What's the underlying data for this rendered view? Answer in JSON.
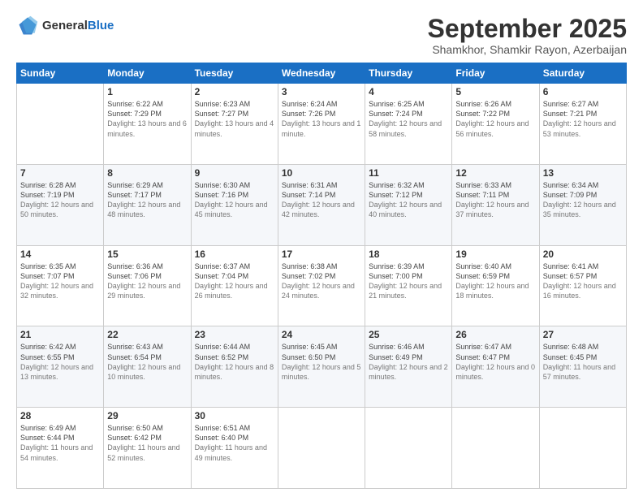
{
  "header": {
    "logo_line1": "General",
    "logo_line2": "Blue",
    "month": "September 2025",
    "location": "Shamkhor, Shamkir Rayon, Azerbaijan"
  },
  "weekdays": [
    "Sunday",
    "Monday",
    "Tuesday",
    "Wednesday",
    "Thursday",
    "Friday",
    "Saturday"
  ],
  "weeks": [
    [
      {
        "day": "",
        "sunrise": "",
        "sunset": "",
        "daylight": ""
      },
      {
        "day": "1",
        "sunrise": "Sunrise: 6:22 AM",
        "sunset": "Sunset: 7:29 PM",
        "daylight": "Daylight: 13 hours and 6 minutes."
      },
      {
        "day": "2",
        "sunrise": "Sunrise: 6:23 AM",
        "sunset": "Sunset: 7:27 PM",
        "daylight": "Daylight: 13 hours and 4 minutes."
      },
      {
        "day": "3",
        "sunrise": "Sunrise: 6:24 AM",
        "sunset": "Sunset: 7:26 PM",
        "daylight": "Daylight: 13 hours and 1 minute."
      },
      {
        "day": "4",
        "sunrise": "Sunrise: 6:25 AM",
        "sunset": "Sunset: 7:24 PM",
        "daylight": "Daylight: 12 hours and 58 minutes."
      },
      {
        "day": "5",
        "sunrise": "Sunrise: 6:26 AM",
        "sunset": "Sunset: 7:22 PM",
        "daylight": "Daylight: 12 hours and 56 minutes."
      },
      {
        "day": "6",
        "sunrise": "Sunrise: 6:27 AM",
        "sunset": "Sunset: 7:21 PM",
        "daylight": "Daylight: 12 hours and 53 minutes."
      }
    ],
    [
      {
        "day": "7",
        "sunrise": "Sunrise: 6:28 AM",
        "sunset": "Sunset: 7:19 PM",
        "daylight": "Daylight: 12 hours and 50 minutes."
      },
      {
        "day": "8",
        "sunrise": "Sunrise: 6:29 AM",
        "sunset": "Sunset: 7:17 PM",
        "daylight": "Daylight: 12 hours and 48 minutes."
      },
      {
        "day": "9",
        "sunrise": "Sunrise: 6:30 AM",
        "sunset": "Sunset: 7:16 PM",
        "daylight": "Daylight: 12 hours and 45 minutes."
      },
      {
        "day": "10",
        "sunrise": "Sunrise: 6:31 AM",
        "sunset": "Sunset: 7:14 PM",
        "daylight": "Daylight: 12 hours and 42 minutes."
      },
      {
        "day": "11",
        "sunrise": "Sunrise: 6:32 AM",
        "sunset": "Sunset: 7:12 PM",
        "daylight": "Daylight: 12 hours and 40 minutes."
      },
      {
        "day": "12",
        "sunrise": "Sunrise: 6:33 AM",
        "sunset": "Sunset: 7:11 PM",
        "daylight": "Daylight: 12 hours and 37 minutes."
      },
      {
        "day": "13",
        "sunrise": "Sunrise: 6:34 AM",
        "sunset": "Sunset: 7:09 PM",
        "daylight": "Daylight: 12 hours and 35 minutes."
      }
    ],
    [
      {
        "day": "14",
        "sunrise": "Sunrise: 6:35 AM",
        "sunset": "Sunset: 7:07 PM",
        "daylight": "Daylight: 12 hours and 32 minutes."
      },
      {
        "day": "15",
        "sunrise": "Sunrise: 6:36 AM",
        "sunset": "Sunset: 7:06 PM",
        "daylight": "Daylight: 12 hours and 29 minutes."
      },
      {
        "day": "16",
        "sunrise": "Sunrise: 6:37 AM",
        "sunset": "Sunset: 7:04 PM",
        "daylight": "Daylight: 12 hours and 26 minutes."
      },
      {
        "day": "17",
        "sunrise": "Sunrise: 6:38 AM",
        "sunset": "Sunset: 7:02 PM",
        "daylight": "Daylight: 12 hours and 24 minutes."
      },
      {
        "day": "18",
        "sunrise": "Sunrise: 6:39 AM",
        "sunset": "Sunset: 7:00 PM",
        "daylight": "Daylight: 12 hours and 21 minutes."
      },
      {
        "day": "19",
        "sunrise": "Sunrise: 6:40 AM",
        "sunset": "Sunset: 6:59 PM",
        "daylight": "Daylight: 12 hours and 18 minutes."
      },
      {
        "day": "20",
        "sunrise": "Sunrise: 6:41 AM",
        "sunset": "Sunset: 6:57 PM",
        "daylight": "Daylight: 12 hours and 16 minutes."
      }
    ],
    [
      {
        "day": "21",
        "sunrise": "Sunrise: 6:42 AM",
        "sunset": "Sunset: 6:55 PM",
        "daylight": "Daylight: 12 hours and 13 minutes."
      },
      {
        "day": "22",
        "sunrise": "Sunrise: 6:43 AM",
        "sunset": "Sunset: 6:54 PM",
        "daylight": "Daylight: 12 hours and 10 minutes."
      },
      {
        "day": "23",
        "sunrise": "Sunrise: 6:44 AM",
        "sunset": "Sunset: 6:52 PM",
        "daylight": "Daylight: 12 hours and 8 minutes."
      },
      {
        "day": "24",
        "sunrise": "Sunrise: 6:45 AM",
        "sunset": "Sunset: 6:50 PM",
        "daylight": "Daylight: 12 hours and 5 minutes."
      },
      {
        "day": "25",
        "sunrise": "Sunrise: 6:46 AM",
        "sunset": "Sunset: 6:49 PM",
        "daylight": "Daylight: 12 hours and 2 minutes."
      },
      {
        "day": "26",
        "sunrise": "Sunrise: 6:47 AM",
        "sunset": "Sunset: 6:47 PM",
        "daylight": "Daylight: 12 hours and 0 minutes."
      },
      {
        "day": "27",
        "sunrise": "Sunrise: 6:48 AM",
        "sunset": "Sunset: 6:45 PM",
        "daylight": "Daylight: 11 hours and 57 minutes."
      }
    ],
    [
      {
        "day": "28",
        "sunrise": "Sunrise: 6:49 AM",
        "sunset": "Sunset: 6:44 PM",
        "daylight": "Daylight: 11 hours and 54 minutes."
      },
      {
        "day": "29",
        "sunrise": "Sunrise: 6:50 AM",
        "sunset": "Sunset: 6:42 PM",
        "daylight": "Daylight: 11 hours and 52 minutes."
      },
      {
        "day": "30",
        "sunrise": "Sunrise: 6:51 AM",
        "sunset": "Sunset: 6:40 PM",
        "daylight": "Daylight: 11 hours and 49 minutes."
      },
      {
        "day": "",
        "sunrise": "",
        "sunset": "",
        "daylight": ""
      },
      {
        "day": "",
        "sunrise": "",
        "sunset": "",
        "daylight": ""
      },
      {
        "day": "",
        "sunrise": "",
        "sunset": "",
        "daylight": ""
      },
      {
        "day": "",
        "sunrise": "",
        "sunset": "",
        "daylight": ""
      }
    ]
  ]
}
